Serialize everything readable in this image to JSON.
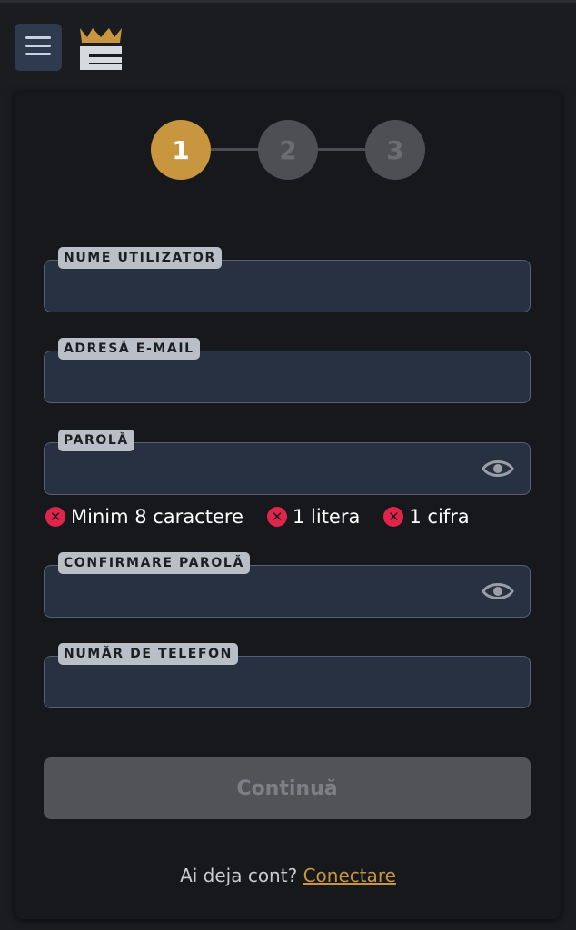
{
  "header": {
    "menu_icon": "hamburger-menu-icon",
    "logo_icon": "crown-e-logo"
  },
  "stepper": {
    "steps": [
      "1",
      "2",
      "3"
    ],
    "active_step": 1,
    "active_color": "#c7963f"
  },
  "form": {
    "username_label": "NUME UTILIZATOR",
    "username_value": "",
    "email_label": "ADRESĂ E-MAIL",
    "email_value": "",
    "password_label": "PAROLĂ",
    "password_value": "",
    "password_rules": [
      "Minim 8 caractere",
      "1 litera",
      "1 cifra"
    ],
    "confirm_password_label": "CONFIRMARE PAROLĂ",
    "confirm_password_value": "",
    "phone_label": "NUMĂR DE TELEFON",
    "phone_value": ""
  },
  "actions": {
    "continue_label": "Continuă",
    "have_account_text": "Ai deja cont?",
    "login_link": "Conectare"
  },
  "colors": {
    "error": "#e0254a",
    "accent": "#c7963f"
  }
}
